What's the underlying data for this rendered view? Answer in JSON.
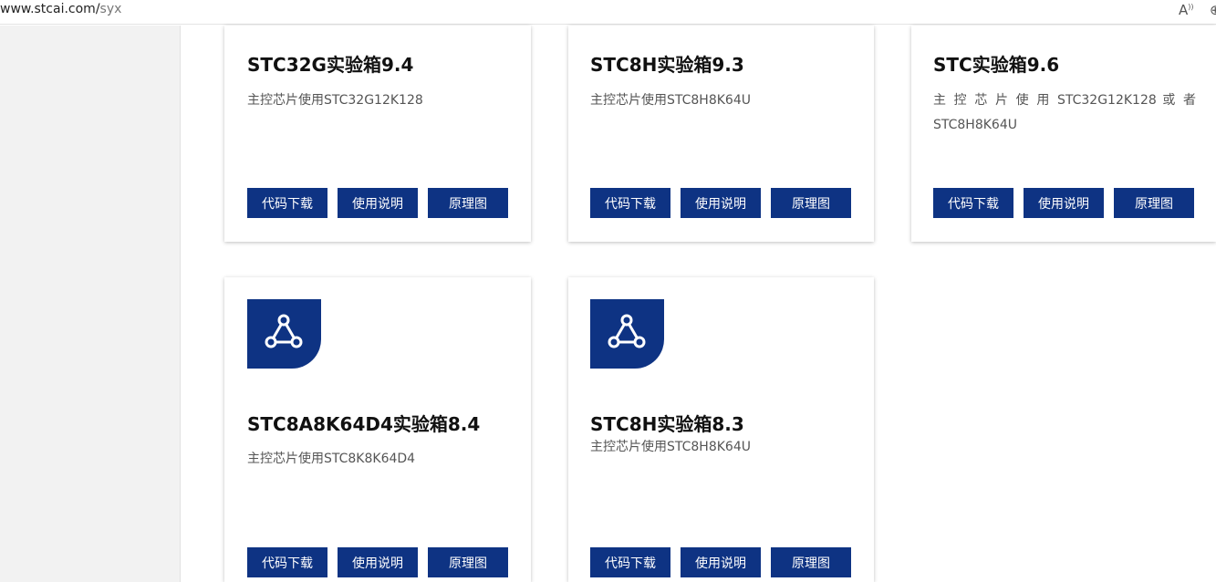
{
  "browser": {
    "url_host": "www.stcai.com/",
    "url_path": "syx",
    "read_aloud_icon": "read-aloud-icon"
  },
  "buttons": {
    "code": "代码下载",
    "manual": "使用说明",
    "schematic": "原理图"
  },
  "cards": [
    {
      "title": "STC32G实验箱9.4",
      "desc": "主控芯片使用STC32G12K128"
    },
    {
      "title": "STC8H实验箱9.3",
      "desc": "主控芯片使用STC8H8K64U"
    },
    {
      "title": "STC实验箱9.6",
      "desc": "主 控 芯 片 使 用 STC32G12K128 或 者 STC8H8K64U"
    },
    {
      "title": "STC8A8K64D4实验箱8.4",
      "desc": "主控芯片使用STC8K8K64D4"
    },
    {
      "title": "STC8H实验箱8.3",
      "desc": "主控芯片使用STC8H8K64U"
    }
  ],
  "colors": {
    "accent": "#0e3383"
  }
}
